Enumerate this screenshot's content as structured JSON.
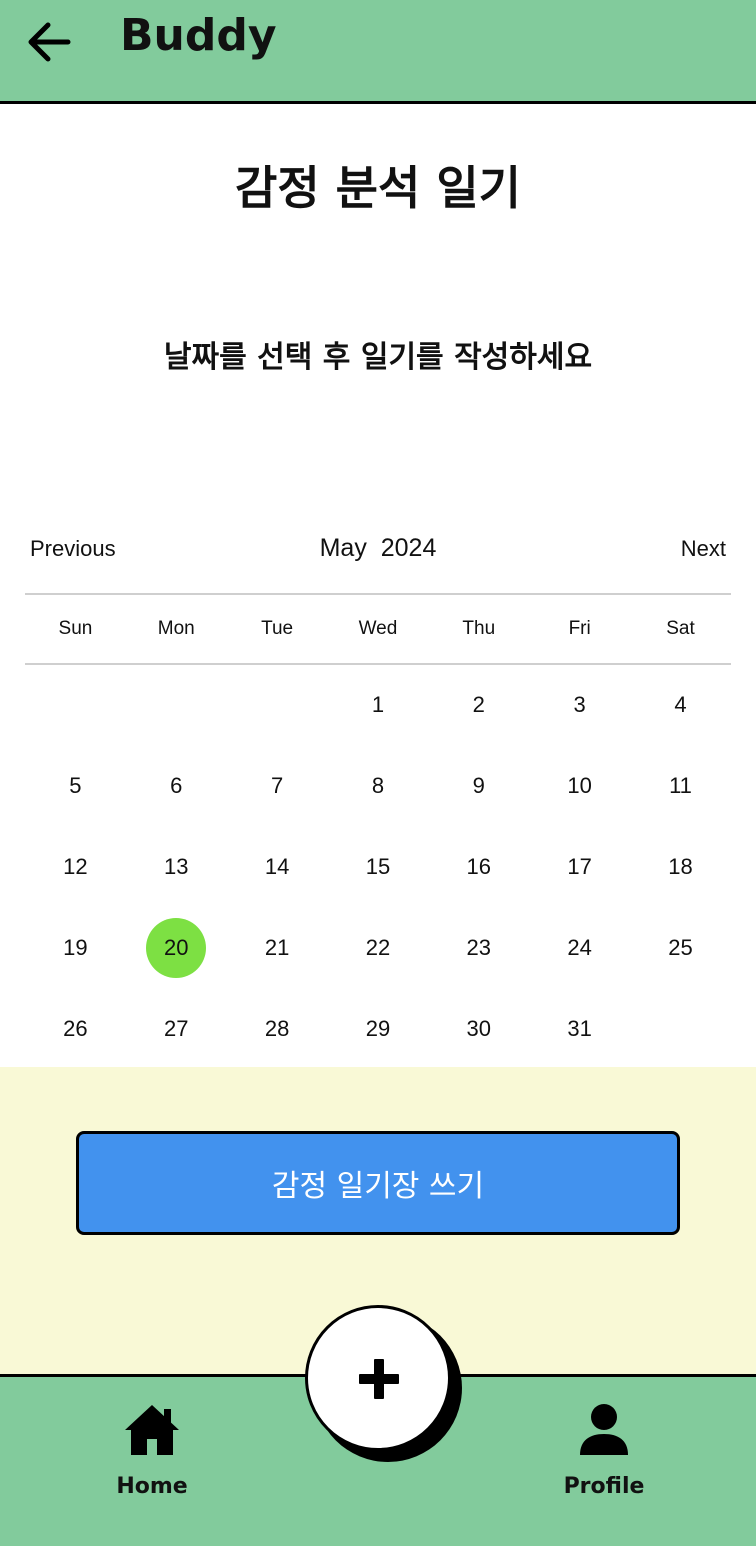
{
  "app": {
    "title": "Buddy"
  },
  "page": {
    "title": "감정 분석 일기",
    "instruction": "날짜를 선택 후 일기를 작성하세요"
  },
  "calendar": {
    "prev_label": "Previous",
    "next_label": "Next",
    "month": "May",
    "year": "2024",
    "weekdays": [
      "Sun",
      "Mon",
      "Tue",
      "Wed",
      "Thu",
      "Fri",
      "Sat"
    ],
    "weeks": [
      [
        "",
        "",
        "",
        "1",
        "2",
        "3",
        "4"
      ],
      [
        "5",
        "6",
        "7",
        "8",
        "9",
        "10",
        "11"
      ],
      [
        "12",
        "13",
        "14",
        "15",
        "16",
        "17",
        "18"
      ],
      [
        "19",
        "20",
        "21",
        "22",
        "23",
        "24",
        "25"
      ],
      [
        "26",
        "27",
        "28",
        "29",
        "30",
        "31",
        ""
      ]
    ],
    "selected_day": "20"
  },
  "actions": {
    "write_button_label": "감정 일기장 쓰기"
  },
  "nav": {
    "home_label": "Home",
    "profile_label": "Profile"
  },
  "icons": {
    "back": "arrow-left-icon",
    "fab": "plus-icon",
    "home": "home-icon",
    "profile": "person-icon"
  },
  "colors": {
    "appbar": "#82cb9c",
    "lower_background": "#f9f9d6",
    "write_button": "#4292ee",
    "selected_day": "#7de043"
  }
}
